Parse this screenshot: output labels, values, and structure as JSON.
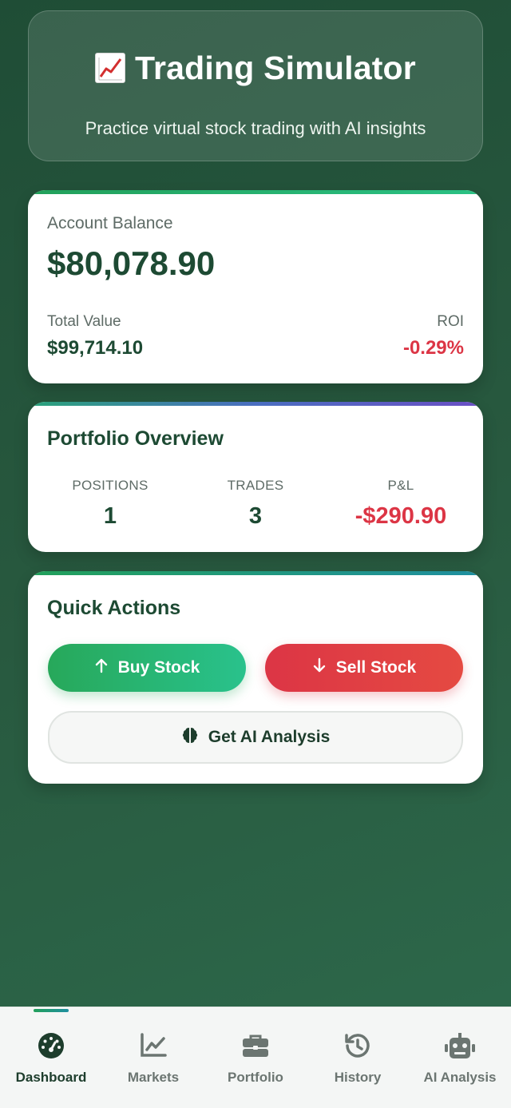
{
  "header": {
    "title": "Trading Simulator",
    "subtitle": "Practice virtual stock trading with AI insights",
    "icon": "chart-increasing-emoji"
  },
  "balance": {
    "label": "Account Balance",
    "value": "$80,078.90",
    "total_value_label": "Total Value",
    "total_value": "$99,714.10",
    "roi_label": "ROI",
    "roi": "-0.29%"
  },
  "portfolio": {
    "title": "Portfolio Overview",
    "stats": [
      {
        "label": "POSITIONS",
        "value": "1"
      },
      {
        "label": "TRADES",
        "value": "3"
      },
      {
        "label": "P&L",
        "value": "-$290.90"
      }
    ]
  },
  "actions": {
    "title": "Quick Actions",
    "buy_label": "Buy Stock",
    "sell_label": "Sell Stock",
    "ai_label": "Get AI Analysis"
  },
  "nav": {
    "items": [
      {
        "label": "Dashboard",
        "icon": "gauge-icon",
        "active": true
      },
      {
        "label": "Markets",
        "icon": "line-chart-icon",
        "active": false
      },
      {
        "label": "Portfolio",
        "icon": "briefcase-icon",
        "active": false
      },
      {
        "label": "History",
        "icon": "history-icon",
        "active": false
      },
      {
        "label": "AI Analysis",
        "icon": "robot-icon",
        "active": false
      }
    ]
  },
  "colors": {
    "accent_green": "#22a05a",
    "negative_red": "#dc3545",
    "dark_text": "#1d4a33"
  }
}
